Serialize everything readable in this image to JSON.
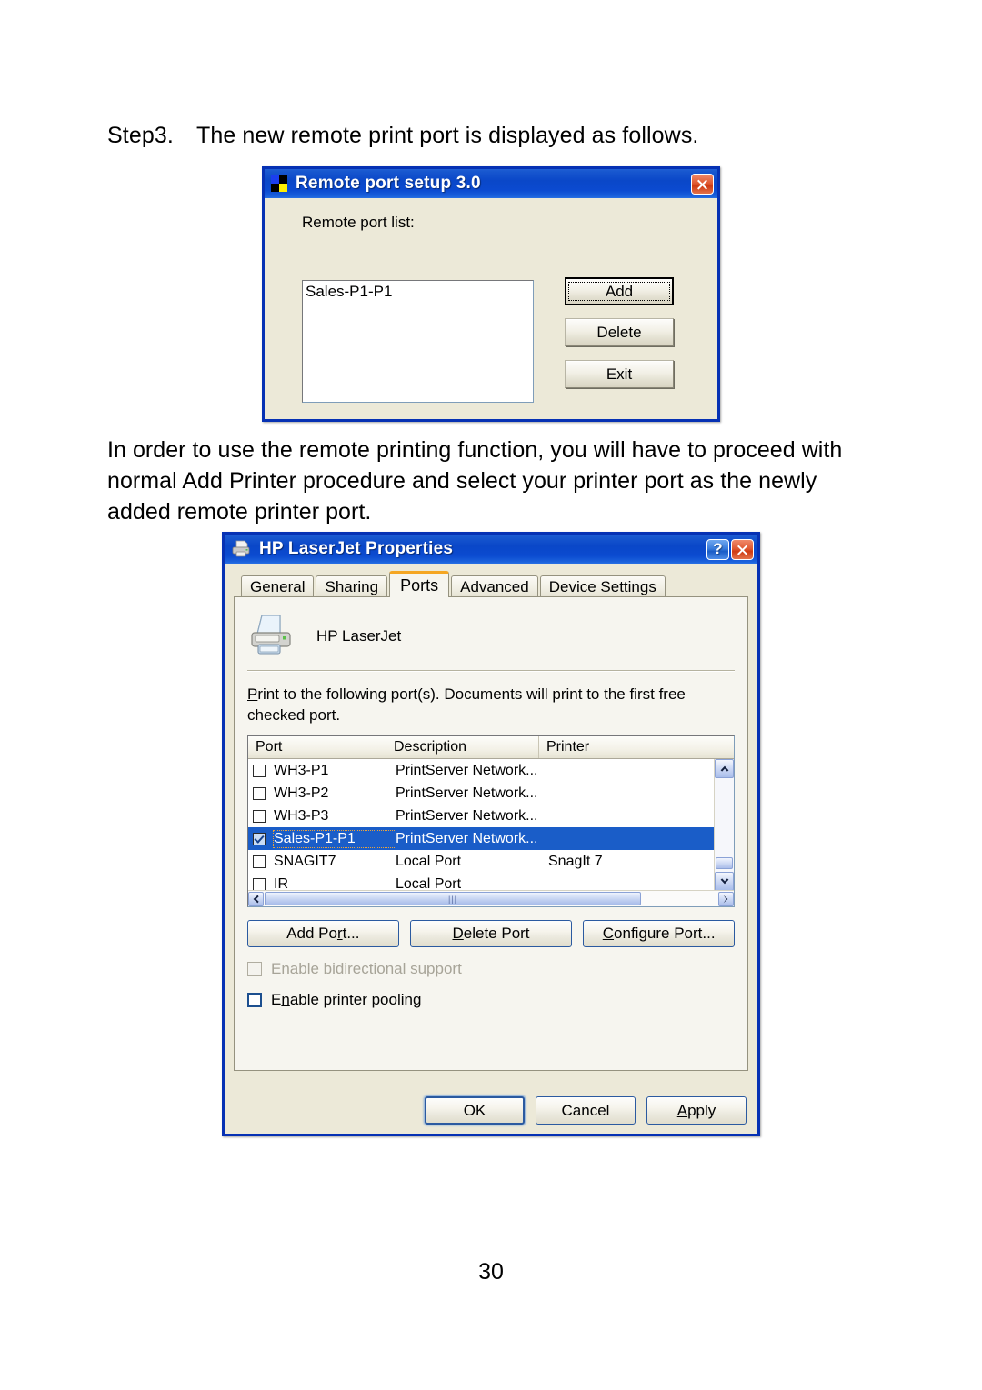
{
  "document": {
    "step": {
      "label": "Step3.",
      "text": "The new remote print port is displayed as follows."
    },
    "paragraph": "In order to use the remote printing function, you will have to proceed with normal Add Printer procedure and select your printer port as the newly added remote printer port.",
    "page_number": "30"
  },
  "remote_port_window": {
    "title": "Remote port setup 3.0",
    "app_icon": "checker-squares-icon",
    "close_icon": "close-icon",
    "list_label": "Remote port list:",
    "list_items": [
      "Sales-P1-P1"
    ],
    "buttons": [
      {
        "label": "Add",
        "focused": true
      },
      {
        "label": "Delete",
        "focused": false
      },
      {
        "label": "Exit",
        "focused": false
      }
    ],
    "colors": {
      "titlebar": "#0b4ad0",
      "body": "#ece9d8",
      "border": "#0631b4"
    }
  },
  "printer_properties_window": {
    "title": "HP LaserJet Properties",
    "title_icon": "printer-icon",
    "help_icon": "question-mark-icon",
    "close_icon": "close-icon",
    "tabs": [
      {
        "label": "General",
        "active": false
      },
      {
        "label": "Sharing",
        "active": false
      },
      {
        "label": "Ports",
        "active": true
      },
      {
        "label": "Advanced",
        "active": false
      },
      {
        "label": "Device Settings",
        "active": false
      }
    ],
    "printer_name": "HP LaserJet",
    "instructions_line1": "Print to the following port(s). Documents will print to the first free",
    "instructions_line2": "checked port.",
    "port_table": {
      "columns": [
        "Port",
        "Description",
        "Printer"
      ],
      "rows": [
        {
          "checked": false,
          "selected": false,
          "port": "WH3-P1",
          "description": "PrintServer Network...",
          "printer": ""
        },
        {
          "checked": false,
          "selected": false,
          "port": "WH3-P2",
          "description": "PrintServer Network...",
          "printer": ""
        },
        {
          "checked": false,
          "selected": false,
          "port": "WH3-P3",
          "description": "PrintServer Network...",
          "printer": ""
        },
        {
          "checked": true,
          "selected": true,
          "port": "Sales-P1-P1",
          "description": "PrintServer Network...",
          "printer": ""
        },
        {
          "checked": false,
          "selected": false,
          "port": "SNAGIT7",
          "description": "Local Port",
          "printer": "SnagIt 7"
        },
        {
          "checked": false,
          "selected": false,
          "port": "IR",
          "description": "Local Port",
          "printer": ""
        }
      ]
    },
    "port_buttons": [
      {
        "label": "Add Port..."
      },
      {
        "label": "Delete Port"
      },
      {
        "label": "Configure Port..."
      }
    ],
    "checkboxes": [
      {
        "label": "Enable bidirectional support",
        "checked": false,
        "disabled": true
      },
      {
        "label": "Enable printer pooling",
        "checked": false,
        "disabled": false
      }
    ],
    "footer_buttons": [
      {
        "label": "OK",
        "default": true
      },
      {
        "label": "Cancel",
        "default": false
      },
      {
        "label": "Apply",
        "default": false
      }
    ],
    "scrollbars": {
      "vertical": {
        "up_icon": "chevron-up-icon",
        "down_icon": "chevron-down-icon"
      },
      "horizontal": {
        "left_icon": "chevron-left-icon",
        "right_icon": "chevron-right-icon"
      }
    },
    "colors": {
      "titlebar": "#0b4ad0",
      "body": "#ece9d8",
      "border": "#0631b4",
      "active_tab_accent": "#f5a623",
      "selection": "#1a5dc8"
    }
  }
}
